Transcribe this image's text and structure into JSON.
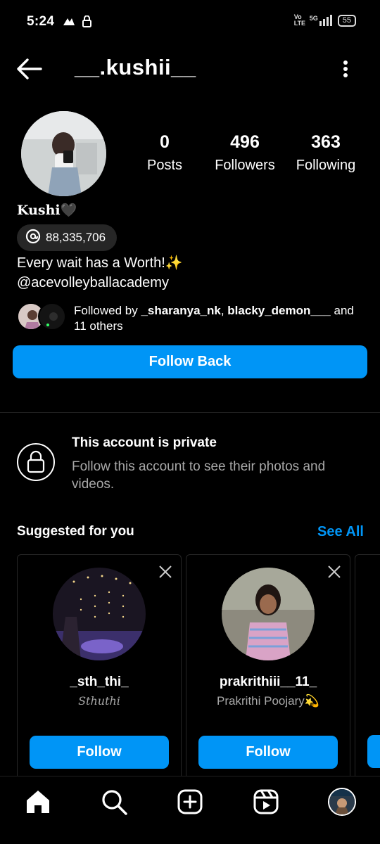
{
  "status": {
    "time": "5:24",
    "network_label": "Vo LTE",
    "signal_label": "5G",
    "battery": "55"
  },
  "profile": {
    "username": "__.kushii__",
    "display_name": "Kushi🖤",
    "threads_count": "88,335,706",
    "bio_line1": "Every wait has a Worth!✨",
    "bio_line2": "@acevolleyballacademy",
    "stats": [
      {
        "value": "0",
        "label": "Posts"
      },
      {
        "value": "496",
        "label": "Followers"
      },
      {
        "value": "363",
        "label": "Following"
      }
    ],
    "followed_by": {
      "prefix": "Followed by ",
      "user1": "_sharanya_nk",
      "sep": ", ",
      "user2": "blacky_demon___",
      "suffix": " and",
      "line2": "11 others"
    },
    "follow_back_label": "Follow Back"
  },
  "private": {
    "title": "This account is private",
    "subtitle": "Follow this account to see their photos and videos."
  },
  "suggested": {
    "title": "Suggested for you",
    "see_all": "See All",
    "cards": [
      {
        "username": "_sth_thi_",
        "name": "Sthuthi",
        "button": "Follow"
      },
      {
        "username": "prakrithiii__11_",
        "name": "Prakrithi Poojary💫",
        "button": "Follow"
      }
    ]
  },
  "colors": {
    "accent": "#0095f6",
    "background": "#000000",
    "secondary_text": "#a8a8a8",
    "surface": "#262626"
  },
  "nav": {
    "icons": [
      "home-icon",
      "search-icon",
      "create-icon",
      "reels-icon",
      "profile-avatar"
    ]
  }
}
